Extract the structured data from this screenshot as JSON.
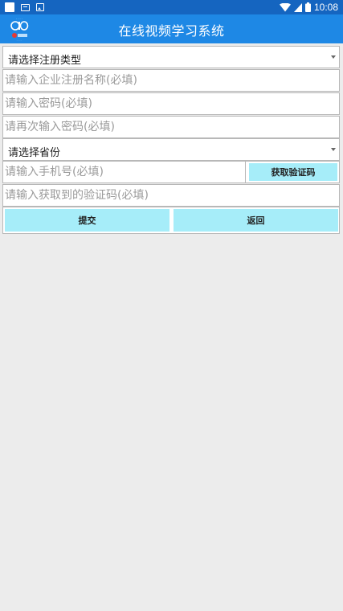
{
  "status_bar": {
    "time": "10:08",
    "icons": [
      "notification-square-icon",
      "message-icon",
      "image-icon",
      "wifi-icon",
      "signal-icon",
      "battery-icon"
    ]
  },
  "app_bar": {
    "title": "在线视频学习系统",
    "logo_icon": "app-logo-icon"
  },
  "form": {
    "registration_type": {
      "selected": "请选择注册类型"
    },
    "company_name": {
      "placeholder": "请输入企业注册名称(必填)",
      "value": ""
    },
    "password": {
      "placeholder": "请输入密码(必填)",
      "value": ""
    },
    "password_confirm": {
      "placeholder": "请再次输入密码(必填)",
      "value": ""
    },
    "province": {
      "selected": "请选择省份"
    },
    "phone": {
      "placeholder": "请输入手机号(必填)",
      "value": ""
    },
    "get_code_label": "获取验证码",
    "code": {
      "placeholder": "请输入获取到的验证码(必填)",
      "value": ""
    },
    "submit_label": "提交",
    "back_label": "返回"
  },
  "colors": {
    "status_bar": "#1565c0",
    "app_bar": "#1e88e5",
    "button": "#a6edf9",
    "background": "#ececec"
  }
}
